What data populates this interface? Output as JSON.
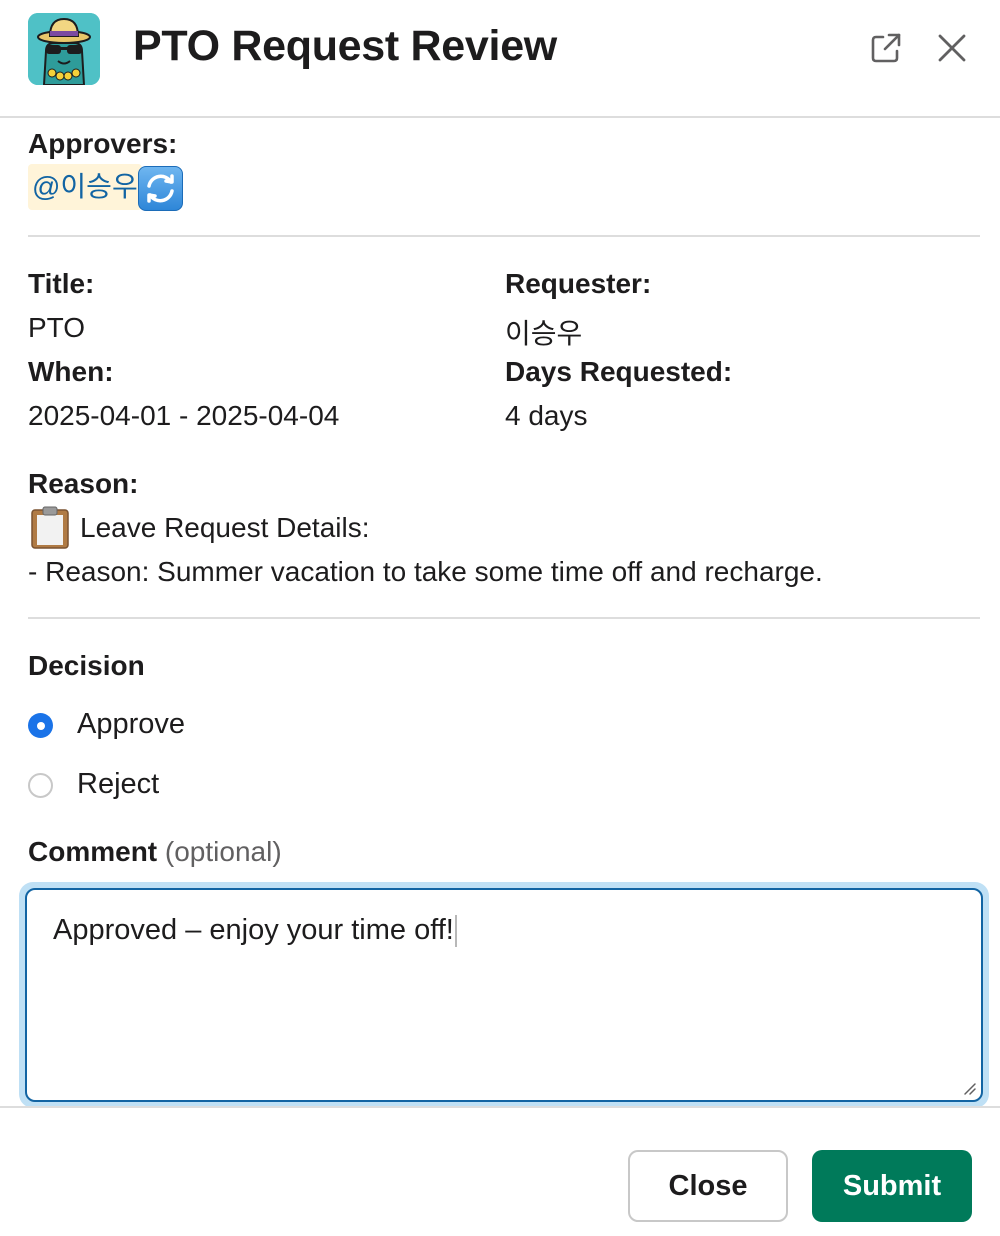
{
  "header": {
    "title": "PTO Request Review",
    "app_icon": "sunglasses-hat-avatar-icon",
    "popout_icon": "external-link-icon",
    "close_icon": "close-icon"
  },
  "approvers": {
    "label": "Approvers:",
    "mention": "@이승우",
    "emoji": "arrows-counterclockwise-icon"
  },
  "details": {
    "title_label": "Title:",
    "title_value": "PTO",
    "requester_label": "Requester:",
    "requester_value": "이승우",
    "when_label": "When:",
    "when_value": "2025-04-01 - 2025-04-04",
    "days_label": "Days Requested:",
    "days_value": "4 days"
  },
  "reason": {
    "label": "Reason:",
    "emoji": "clipboard-icon",
    "line1": "Leave Request Details:",
    "line2": "- Reason: Summer vacation to take some time off and recharge."
  },
  "decision": {
    "label": "Decision",
    "options": [
      {
        "label": "Approve",
        "selected": true
      },
      {
        "label": "Reject",
        "selected": false
      }
    ]
  },
  "comment": {
    "label": "Comment",
    "optional_label": "(optional)",
    "value": "Approved – enjoy your time off!"
  },
  "footer": {
    "close_label": "Close",
    "submit_label": "Submit"
  },
  "colors": {
    "primary_button": "#007a5a",
    "mention_text": "#1264a3",
    "mention_background": "#fff4d9",
    "radio_selected": "#1a73e8",
    "focus_ring": "#bfe0f5"
  }
}
